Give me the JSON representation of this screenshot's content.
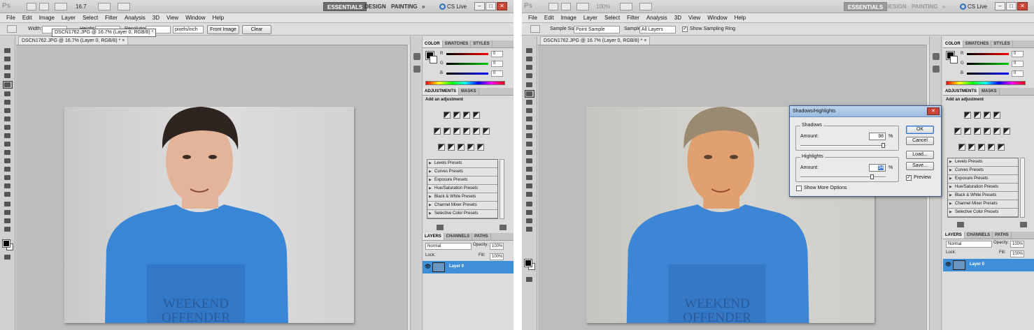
{
  "menu": [
    "File",
    "Edit",
    "Image",
    "Layer",
    "Select",
    "Filter",
    "Analysis",
    "3D",
    "View",
    "Window",
    "Help"
  ],
  "titlebar": {
    "left_zoom": "16.7",
    "right_zoom": "100%",
    "workspaces": [
      "ESSENTIALS",
      "DESIGN",
      "PAINTING"
    ],
    "more": "»",
    "cs_live": "CS Live",
    "min": "–",
    "max": "□",
    "close": "✕"
  },
  "left_options": {
    "width_label": "Width:",
    "height_label": "Height:",
    "resolution_label": "Resolution:",
    "unit": "pixels/inch",
    "front_image": "Front Image",
    "clear": "Clear",
    "tooltip": "DSCN1762.JPG @ 16.7% (Layer 0, RGB/8) *"
  },
  "right_options": {
    "sample_size_label": "Sample Size:",
    "sample_size_value": "Point Sample",
    "sample_label": "Sample:",
    "sample_value": "All Layers",
    "ring_label": "Show Sampling Ring",
    "ring_checked": "✓"
  },
  "doc_tab": "DSCN1762.JPG @ 16.7% (Layer 0, RGB/8) *",
  "doc_tab_close": "×",
  "color_panel": {
    "tabs": [
      "COLOR",
      "SWATCHES",
      "STYLES"
    ],
    "channels": [
      {
        "label": "R",
        "value": "0",
        "color": "#d42020"
      },
      {
        "label": "G",
        "value": "0",
        "color": "#20a020"
      },
      {
        "label": "B",
        "value": "0",
        "color": "#2020d0"
      }
    ]
  },
  "adjustments": {
    "tabs": [
      "ADJUSTMENTS",
      "MASKS"
    ],
    "title": "Add an adjustment",
    "presets": [
      "Levels Presets",
      "Curves Presets",
      "Exposure Presets",
      "Hue/Saturation Presets",
      "Black & White Presets",
      "Channel Mixer Presets",
      "Selective Color Presets"
    ]
  },
  "layers": {
    "tabs": [
      "LAYERS",
      "CHANNELS",
      "PATHS"
    ],
    "blend_mode": "Normal",
    "opacity_label": "Opacity:",
    "opacity_value": "100%",
    "lock_label": "Lock:",
    "fill_label": "Fill:",
    "fill_value": "100%",
    "layer_name": "Layer 0",
    "eye": "👁"
  },
  "dialog": {
    "title": "Shadows/Highlights",
    "close": "✕",
    "shadows_label": "Shadows",
    "shadows_amount_label": "Amount:",
    "shadows_amount": "98",
    "shadows_percent": 98,
    "highlights_label": "Highlights",
    "highlights_amount_label": "Amount:",
    "highlights_amount": "94",
    "highlights_percent": 94,
    "percent_sign": "%",
    "ok": "OK",
    "cancel": "Cancel",
    "load": "Load...",
    "save": "Save...",
    "preview_label": "Preview",
    "preview_checked": "✓",
    "more_options_label": "Show More Options"
  },
  "shirt_text": [
    "WEEKEND",
    "OFFENDER"
  ],
  "colors": {
    "shirt_left": "#3a86d6",
    "shirt_right": "#3d86d6",
    "skin_left": "#e4b49a",
    "skin_right": "#e0a070",
    "hair_left": "#2e2520",
    "hair_right": "#9a8a72",
    "accent": "#3f8fd8"
  }
}
